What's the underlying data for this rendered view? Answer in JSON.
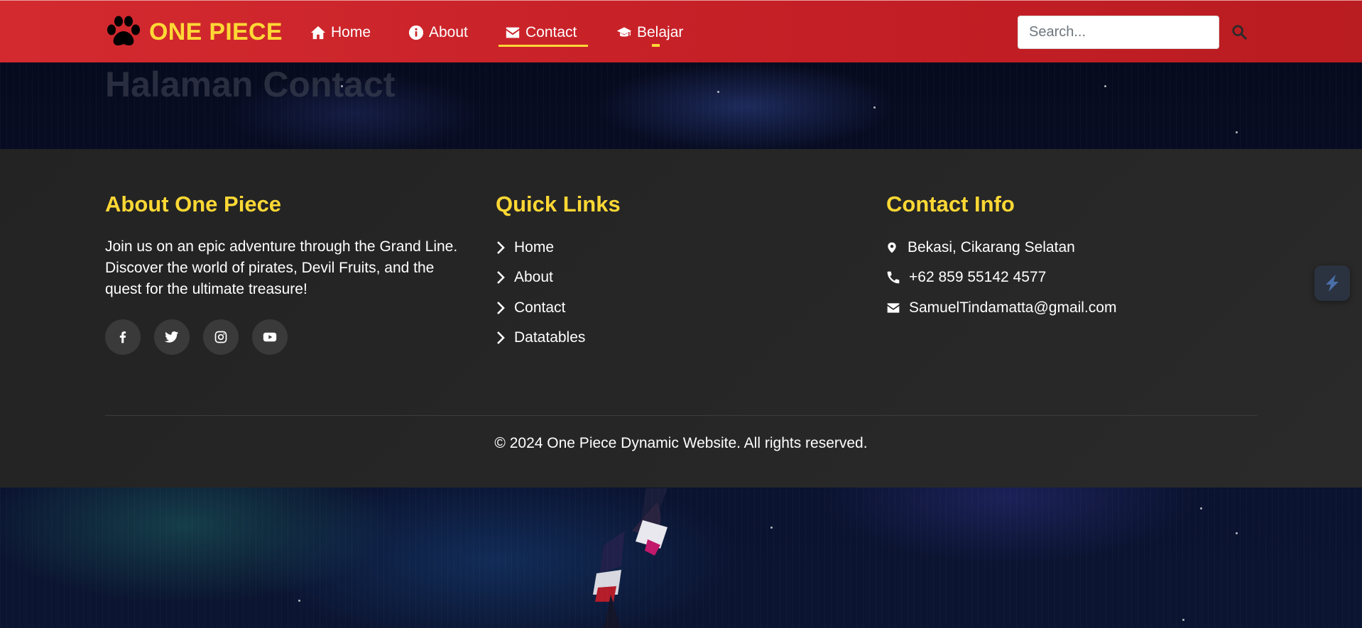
{
  "brand": {
    "name": "ONE PIECE",
    "icon": "paw-icon"
  },
  "nav": {
    "items": [
      {
        "label": "Home",
        "icon": "home-icon"
      },
      {
        "label": "About",
        "icon": "info-icon"
      },
      {
        "label": "Contact",
        "icon": "envelope-icon",
        "active": true
      },
      {
        "label": "Belajar",
        "icon": "graduation-cap-icon"
      }
    ]
  },
  "search": {
    "placeholder": "Search...",
    "icon": "search-icon"
  },
  "page": {
    "title": "Halaman Contact"
  },
  "footer": {
    "about": {
      "title": "About One Piece",
      "text": "Join us on an epic adventure through the Grand Line. Discover the world of pirates, Devil Fruits, and the quest for the ultimate treasure!",
      "social": [
        "facebook-icon",
        "twitter-icon",
        "instagram-icon",
        "youtube-icon"
      ]
    },
    "links": {
      "title": "Quick Links",
      "items": [
        "Home",
        "About",
        "Contact",
        "Datatables"
      ]
    },
    "contact": {
      "title": "Contact Info",
      "address": "Bekasi, Cikarang Selatan",
      "phone": "+62 859 55142 4577",
      "email": "SamuelTindamatta@gmail.com"
    },
    "copyright": "© 2024 One Piece Dynamic Website. All rights reserved."
  },
  "colors": {
    "navbar": "#d32a2f",
    "accent": "#fdd835",
    "footer_bg": "#262626"
  }
}
